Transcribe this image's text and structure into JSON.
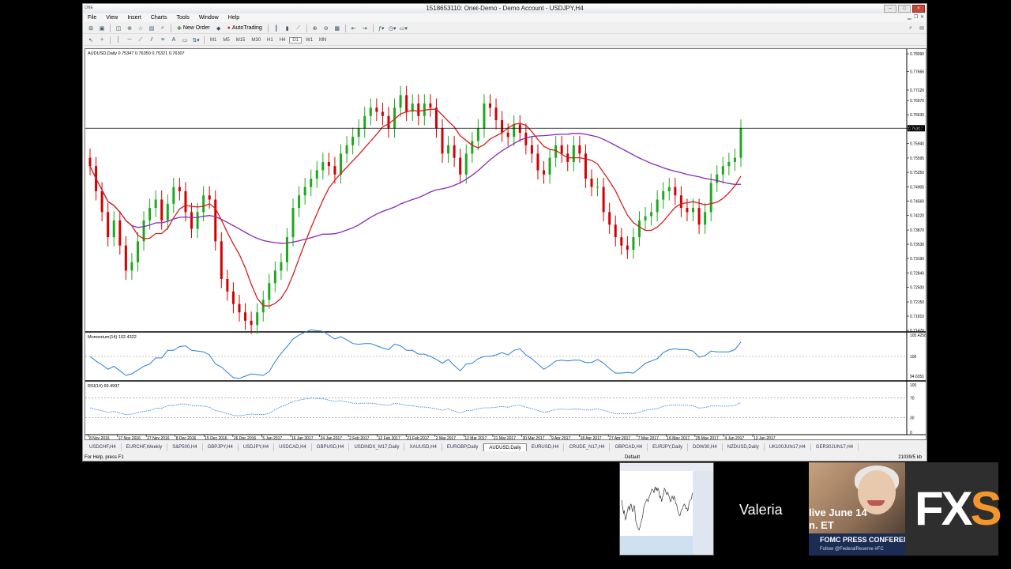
{
  "window": {
    "title": "1518653110: Oneℓ-Demo - Demo Account - USDJPY,H4",
    "app_icon": "ONE"
  },
  "menu": [
    "File",
    "View",
    "Insert",
    "Charts",
    "Tools",
    "Window",
    "Help"
  ],
  "toolbar": {
    "new_order": "New Order",
    "auto_trading": "AutoTrading"
  },
  "timeframes": [
    "M1",
    "M5",
    "M15",
    "M30",
    "H1",
    "H4",
    "D1",
    "W1",
    "MN"
  ],
  "chart": {
    "info": "AUDUSD,Daily  0.75347 0.76350 0.75321 0.76307",
    "momentum_label": "Momentum(14) 102.4322",
    "rsi_label": "RSI(14) 69.4997",
    "main_ticks": [
      "0.78090",
      "0.77665",
      "0.77220",
      "0.76970",
      "0.76630",
      "0.76305",
      "0.75940",
      "0.75595",
      "0.75250",
      "0.74905",
      "0.74560",
      "0.74220",
      "0.73870",
      "0.73530",
      "0.73190",
      "0.72840",
      "0.72500",
      "0.72150",
      "0.71810",
      "0.71470"
    ],
    "current_price": "0.76307",
    "momentum_ticks": [
      "105.4258",
      "100",
      "94.6351"
    ],
    "rsi_ticks": [
      "100",
      "70",
      "30",
      "0"
    ],
    "date_labels": [
      "8 Nov 2016",
      "17 Nov 2016",
      "27 Nov 2016",
      "8 Dec 2016",
      "15 Dec 2016",
      "26 Dec 2016",
      "5 Jan 2017",
      "16 Jan 2017",
      "24 Jan 2017",
      "2 Feb 2017",
      "12 Feb 2017",
      "21 Feb 2017",
      "2 Mar 2017",
      "12 Mar 2017",
      "21 Mar 2017",
      "30 Mar 2017",
      "9 Apr 2017",
      "18 Apr 2017",
      "27 Apr 2017",
      "7 May 2017",
      "16 May 2017",
      "25 May 2017",
      "4 Jun 2017",
      "13 Jun 2017"
    ],
    "colors": {
      "bull": "#1fa81f",
      "bear": "#d40000",
      "ma_fast": "#d51f1f",
      "ma_slow": "#8a2ab8",
      "oscillator": "#2a7fd4"
    }
  },
  "chart_data": {
    "type": "candlestick",
    "title": "AUDUSD,Daily",
    "close_series": [
      0.754,
      0.748,
      0.743,
      0.737,
      0.741,
      0.735,
      0.729,
      0.731,
      0.736,
      0.741,
      0.744,
      0.746,
      0.741,
      0.745,
      0.749,
      0.748,
      0.743,
      0.739,
      0.743,
      0.747,
      0.746,
      0.736,
      0.727,
      0.724,
      0.721,
      0.719,
      0.717,
      0.716,
      0.719,
      0.722,
      0.726,
      0.729,
      0.731,
      0.737,
      0.744,
      0.747,
      0.749,
      0.751,
      0.753,
      0.755,
      0.754,
      0.752,
      0.757,
      0.759,
      0.761,
      0.763,
      0.766,
      0.768,
      0.767,
      0.766,
      0.763,
      0.768,
      0.771,
      0.767,
      0.769,
      0.766,
      0.769,
      0.768,
      0.763,
      0.757,
      0.759,
      0.756,
      0.752,
      0.757,
      0.76,
      0.763,
      0.769,
      0.768,
      0.765,
      0.762,
      0.761,
      0.764,
      0.762,
      0.759,
      0.757,
      0.753,
      0.752,
      0.756,
      0.759,
      0.757,
      0.755,
      0.759,
      0.757,
      0.751,
      0.749,
      0.749,
      0.743,
      0.74,
      0.737,
      0.735,
      0.734,
      0.737,
      0.741,
      0.742,
      0.743,
      0.746,
      0.748,
      0.749,
      0.747,
      0.744,
      0.743,
      0.744,
      0.74,
      0.743,
      0.75,
      0.752,
      0.754,
      0.755,
      0.756,
      0.763
    ],
    "ma_fast_label": "SMA(20)",
    "ma_slow_label": "SMA(100)",
    "ylim": [
      0.7147,
      0.7809
    ]
  },
  "tabs": [
    "USDCHF,H4",
    "EURCHF,Weekly",
    "S&P500,H4",
    "GBPJPY,H4",
    "USDJPY,H4",
    "USDCAD,H4",
    "GBPUSD,H4",
    "USDINDX_M17,Daily",
    "XAUUSD,H4",
    "EURGBP,Daily",
    "AUDUSD,Daily",
    "EURUSD,H4",
    "CRUDE_N17,H4",
    "GBPCAD,H4",
    "EURJPY,Daily",
    "DOW30,H4",
    "NZDUSD,Daily",
    "UK100JUN17,H4",
    "GER30JUN17,H4"
  ],
  "active_tab": "AUDUSD,Daily",
  "status": {
    "help": "For Help, press F1",
    "profile": "Default",
    "traffic": "21039/5 kb"
  },
  "overlay": {
    "presenter_name": "Valeria",
    "cam_line1": "live June 14",
    "cam_line2": "n. ET",
    "cam_banner": "FOMC PRESS CONFERENC",
    "cam_follow": "Follow @FederalReserve #FC",
    "logo": "FXS"
  }
}
